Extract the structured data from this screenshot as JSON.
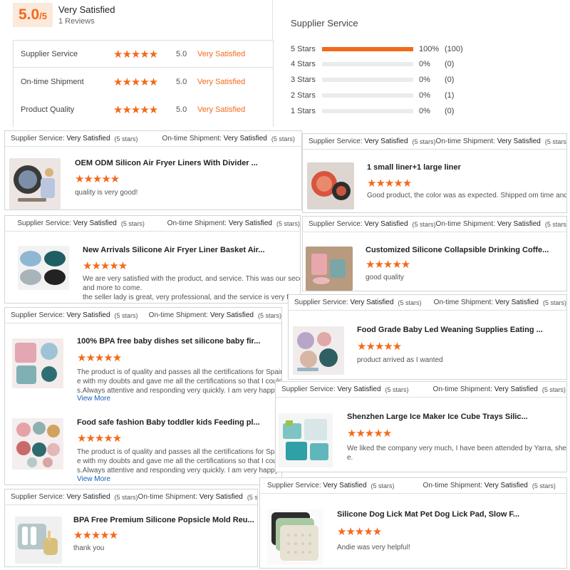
{
  "summary": {
    "score": "5.0",
    "score_suffix": "/5",
    "overall": "Very Satisfied",
    "reviews": "1 Reviews",
    "ratings": [
      {
        "label": "Supplier Service",
        "stars": 5,
        "value": "5.0",
        "text": "Very Satisfied"
      },
      {
        "label": "On-time Shipment",
        "stars": 5,
        "value": "5.0",
        "text": "Very Satisfied"
      },
      {
        "label": "Product Quality",
        "stars": 5,
        "value": "5.0",
        "text": "Very Satisfied"
      }
    ],
    "distribution_title": "Supplier Service",
    "distribution": [
      {
        "label": "5 Stars",
        "percent": 100,
        "pct_text": "100%",
        "count": "(100)"
      },
      {
        "label": "4 Stars",
        "percent": 0,
        "pct_text": "0%",
        "count": "(0)"
      },
      {
        "label": "3 Stars",
        "percent": 0,
        "pct_text": "0%",
        "count": "(0)"
      },
      {
        "label": "2 Stars",
        "percent": 0,
        "pct_text": "0%",
        "count": "(1)"
      },
      {
        "label": "1 Stars",
        "percent": 0,
        "pct_text": "0%",
        "count": "(0)"
      }
    ]
  },
  "common": {
    "supplier_label": "Supplier Service:",
    "shipment_label": "On-time Shipment:",
    "very_satisfied": "Very Satisfied",
    "five_stars": "(5 stars)",
    "view_more": "View More",
    "accent": "#f26a1b"
  },
  "cards": [
    {
      "title": "OEM ODM Silicon Air Fryer Liners With Divider ...",
      "lines": [
        "quality is very good!"
      ]
    },
    {
      "title": "1 small liner+1 large liner",
      "lines": [
        "Good product, the color was as expected. Shipped om time and grea"
      ]
    },
    {
      "title": "New Arrivals Silicone Air Fryer Liner Basket Air...",
      "lines": [
        "We are very satisfied with the product, and service. This was our secon",
        "and more to come.",
        "the seller lady is great, very professional, and the service is very fast"
      ]
    },
    {
      "title": "Customized Silicone Collapsible Drinking Coffe...",
      "lines": [
        "good quality"
      ]
    },
    {
      "title": "100% BPA free baby dishes set silicone baby fir...",
      "lines": [
        "The product is of quality and passes all the certifications for Spain.",
        "e with my doubts and gave me all the certifications so that I could",
        "s.Always attentive and responding very quickly. I am very happy"
      ]
    },
    {
      "title": "Food Grade Baby Led Weaning Supplies Eating ...",
      "lines": [
        "product arrived as I wanted"
      ]
    },
    {
      "title": "Food safe fashion Baby toddler kids Feeding pl...",
      "lines": [
        "The product is of quality and passes all the certifications for Spa",
        "e with my doubts and gave me all the certifications so that I could",
        "s.Always attentive and responding very quickly. I am very happy"
      ]
    },
    {
      "title": "Shenzhen Large Ice Maker Ice Cube Trays Silic...",
      "lines": [
        "We liked the company very much, I have been attended by Yarra, she",
        "e."
      ]
    },
    {
      "title": "BPA Free Premium Silicone Popsicle Mold Reu...",
      "lines": [
        "thank you"
      ]
    },
    {
      "title": "Silicone Dog Lick Mat Pet Dog Lick Pad, Slow F...",
      "lines": [
        "Andie was very helpful!"
      ]
    }
  ]
}
